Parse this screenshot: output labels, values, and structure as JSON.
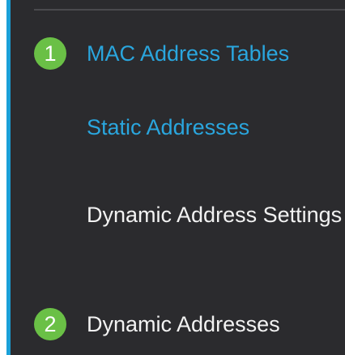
{
  "nav": {
    "items": [
      {
        "badge": "1",
        "label": "MAC Address Tables"
      },
      {
        "label": "Static Addresses"
      },
      {
        "label_line1": "Dynamic Address",
        "label_line2": "Settings"
      },
      {
        "badge": "2",
        "label": "Dynamic Addresses"
      }
    ]
  },
  "colors": {
    "panel_background": "#2b2b2e",
    "accent_bar": "#1aa0d8",
    "active_link": "#2aa6de",
    "default_text": "#f2f2f2",
    "badge": "#6ac046"
  }
}
